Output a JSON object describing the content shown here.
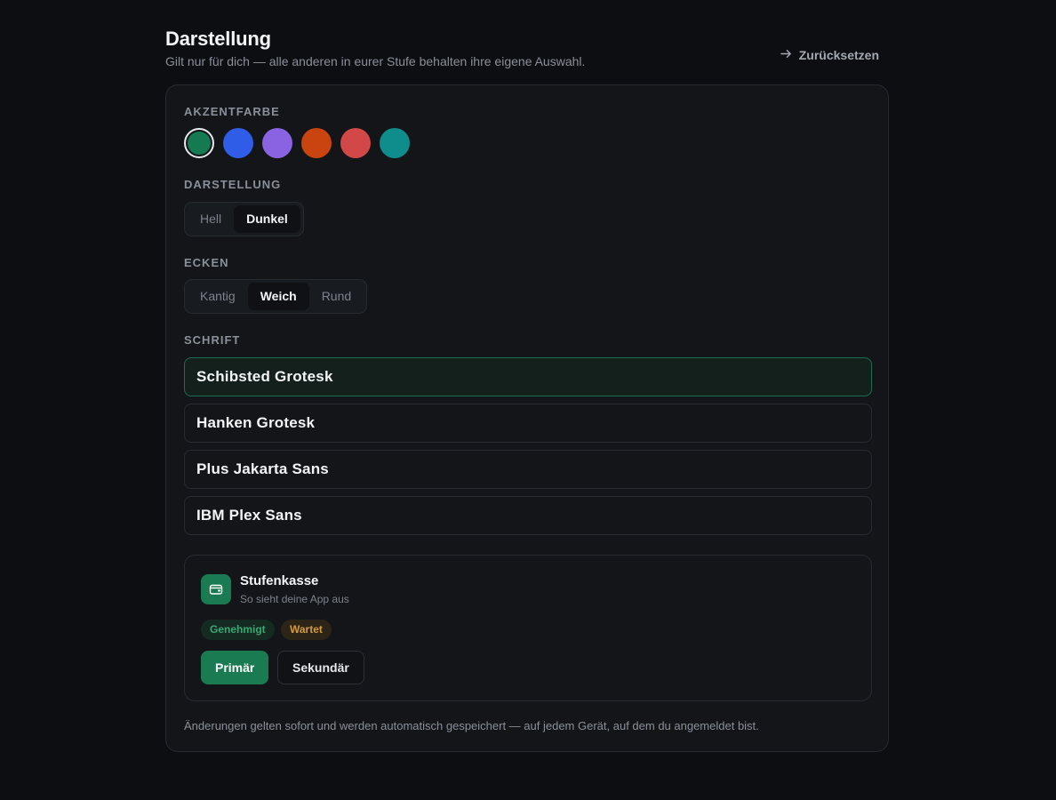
{
  "header": {
    "title": "Darstellung",
    "subtitle": "Gilt nur für dich — alle anderen in eurer Stufe behalten ihre eigene Auswahl.",
    "reset_label": "Zurücksetzen"
  },
  "accent": {
    "label": "AKZENTFARBE",
    "selected_index": 0,
    "colors": [
      "#157a52",
      "#2f5de8",
      "#8a63e3",
      "#c9440f",
      "#d24747",
      "#0f8c8c"
    ]
  },
  "appearance": {
    "label": "DARSTELLUNG",
    "options": [
      "Hell",
      "Dunkel"
    ],
    "selected": "Dunkel"
  },
  "corners": {
    "label": "ECKEN",
    "options": [
      "Kantig",
      "Weich",
      "Rund"
    ],
    "selected": "Weich"
  },
  "font": {
    "label": "SCHRIFT",
    "options": [
      "Schibsted Grotesk",
      "Hanken Grotesk",
      "Plus Jakarta Sans",
      "IBM Plex Sans"
    ],
    "selected": "Schibsted Grotesk"
  },
  "preview": {
    "title": "Stufenkasse",
    "subtitle": "So sieht deine App aus",
    "badge_approved": "Genehmigt",
    "badge_waiting": "Wartet",
    "primary_label": "Primär",
    "secondary_label": "Sekundär",
    "icon": "wallet-icon"
  },
  "footnote": "Änderungen gelten sofort und werden automatisch gespeichert — auf jedem Gerät, auf dem du angemeldet bist."
}
